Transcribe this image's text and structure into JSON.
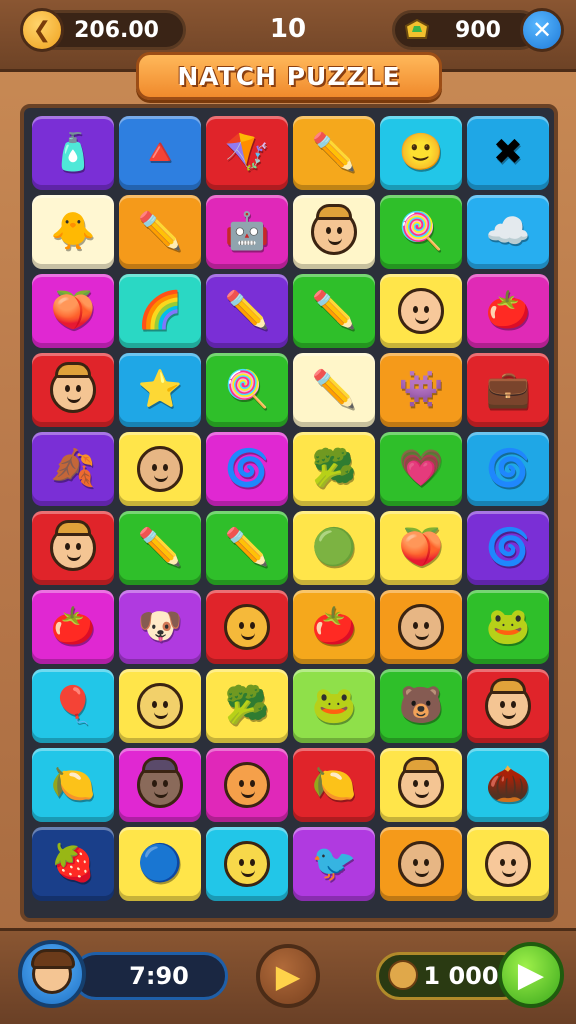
{
  "header": {
    "coins_value": "206.00",
    "level_number": "10",
    "gems_value": "900",
    "close_symbol": "✕",
    "coin_symbol": "❮"
  },
  "title": "NATCH PUZZLE",
  "board": {
    "rows": [
      [
        {
          "color": "#7a2fd6",
          "icon": "bottle",
          "glyph": "🧴"
        },
        {
          "color": "#2e7fe0",
          "icon": "triangle-ruler",
          "glyph": "🔺"
        },
        {
          "color": "#e0242a",
          "icon": "paper-kite",
          "glyph": "🪁"
        },
        {
          "color": "#f5a81c",
          "icon": "pencil",
          "glyph": "✏️"
        },
        {
          "color": "#22c6e8",
          "icon": "smiley-ball",
          "glyph": "🙂"
        },
        {
          "color": "#1fa7e6",
          "icon": "star-cross",
          "glyph": "✖"
        }
      ],
      [
        {
          "color": "#fff7d2",
          "icon": "chick",
          "glyph": "🐥"
        },
        {
          "color": "#f59a1a",
          "icon": "pencil",
          "glyph": "✏️"
        },
        {
          "color": "#e028b9",
          "icon": "robot",
          "glyph": "🤖"
        },
        {
          "color": "#fff6c9",
          "icon": "explorer-face",
          "glyph": "face-hat"
        },
        {
          "color": "#2fbf2a",
          "icon": "popsicle",
          "glyph": "🍭"
        },
        {
          "color": "#27aef0",
          "icon": "cloud-creature",
          "glyph": "☁️"
        }
      ],
      [
        {
          "color": "#e028d2",
          "icon": "peach",
          "glyph": "🍑"
        },
        {
          "color": "#2ad8c4",
          "icon": "rainbow-shell",
          "glyph": "🌈"
        },
        {
          "color": "#7a2fd6",
          "icon": "pencil",
          "glyph": "✏️"
        },
        {
          "color": "#2fbf2a",
          "icon": "pencil",
          "glyph": "✏️"
        },
        {
          "color": "#ffe54a",
          "icon": "baby-face",
          "glyph": "face"
        },
        {
          "color": "#e02ab6",
          "icon": "tomato",
          "glyph": "🍅"
        }
      ],
      [
        {
          "color": "#e0242a",
          "icon": "explorer-face",
          "glyph": "face-hat"
        },
        {
          "color": "#1fa7e6",
          "icon": "star",
          "glyph": "⭐"
        },
        {
          "color": "#2fbf2a",
          "icon": "lollipop",
          "glyph": "🍭"
        },
        {
          "color": "#fff6c9",
          "icon": "pencil",
          "glyph": "✏️"
        },
        {
          "color": "#f59a1a",
          "icon": "purple-monster",
          "glyph": "👾"
        },
        {
          "color": "#e0242a",
          "icon": "briefcase",
          "glyph": "💼"
        }
      ],
      [
        {
          "color": "#7a2fd6",
          "icon": "leaf",
          "glyph": "🍂"
        },
        {
          "color": "#ffe54a",
          "icon": "cookie-face",
          "glyph": "face"
        },
        {
          "color": "#e028d2",
          "icon": "snail-swirl",
          "glyph": "🌀"
        },
        {
          "color": "#ffe54a",
          "icon": "broccoli",
          "glyph": "🥦"
        },
        {
          "color": "#2fbf2a",
          "icon": "heart-apple",
          "glyph": "💗"
        },
        {
          "color": "#1fa7e6",
          "icon": "swirl-candy",
          "glyph": "🌀"
        }
      ],
      [
        {
          "color": "#e0242a",
          "icon": "explorer-face",
          "glyph": "face-hat"
        },
        {
          "color": "#2fbf2a",
          "icon": "pencil",
          "glyph": "✏️"
        },
        {
          "color": "#2fbf2a",
          "icon": "pencil",
          "glyph": "✏️"
        },
        {
          "color": "#ffe54a",
          "icon": "green-ball",
          "glyph": "🟢"
        },
        {
          "color": "#ffe54a",
          "icon": "pink-fruit",
          "glyph": "🍑"
        },
        {
          "color": "#7a2fd6",
          "icon": "swirl-candy",
          "glyph": "🌀"
        }
      ],
      [
        {
          "color": "#e028d2",
          "icon": "tomato",
          "glyph": "🍅"
        },
        {
          "color": "#b03ae0",
          "icon": "yellow-dog",
          "glyph": "🐶"
        },
        {
          "color": "#e0242a",
          "icon": "sun-face",
          "glyph": "face"
        },
        {
          "color": "#f5a81c",
          "icon": "tomato",
          "glyph": "🍅"
        },
        {
          "color": "#f59a1a",
          "icon": "cookie-face",
          "glyph": "face"
        },
        {
          "color": "#2fbf2a",
          "icon": "green-frog",
          "glyph": "🐸"
        }
      ],
      [
        {
          "color": "#22c6e8",
          "icon": "balloon",
          "glyph": "🎈"
        },
        {
          "color": "#ffe54a",
          "icon": "bunny-face",
          "glyph": "face"
        },
        {
          "color": "#ffe54a",
          "icon": "broccoli",
          "glyph": "🥦"
        },
        {
          "color": "#8fe04a",
          "icon": "frog-face",
          "glyph": "🐸"
        },
        {
          "color": "#2fbf2a",
          "icon": "bear-face",
          "glyph": "🐻"
        },
        {
          "color": "#e0242a",
          "icon": "explorer-face",
          "glyph": "face-hat"
        }
      ],
      [
        {
          "color": "#22c6e8",
          "icon": "lemon",
          "glyph": "🍋"
        },
        {
          "color": "#e028d2",
          "icon": "dark-face",
          "glyph": "face-hat"
        },
        {
          "color": "#e028b9",
          "icon": "orange-face",
          "glyph": "face"
        },
        {
          "color": "#e0242a",
          "icon": "lemon-face",
          "glyph": "🍋"
        },
        {
          "color": "#ffe54a",
          "icon": "explorer-face",
          "glyph": "face-hat"
        },
        {
          "color": "#22c6e8",
          "icon": "chestnut-face",
          "glyph": "🌰"
        }
      ],
      [
        {
          "color": "#1a3f8a",
          "icon": "strawberry",
          "glyph": "🍓"
        },
        {
          "color": "#ffe54a",
          "icon": "blue-ball",
          "glyph": "🔵"
        },
        {
          "color": "#22c6e8",
          "icon": "yellow-face",
          "glyph": "face"
        },
        {
          "color": "#b03ae0",
          "icon": "green-bird",
          "glyph": "🐦"
        },
        {
          "color": "#f59a1a",
          "icon": "cookie-face",
          "glyph": "face"
        },
        {
          "color": "#ffe54a",
          "icon": "baby-face",
          "glyph": "face"
        }
      ]
    ]
  },
  "footer": {
    "score_value": "7:90",
    "play_symbol": "▶",
    "moves_value": "1 000",
    "next_symbol": "▶"
  }
}
